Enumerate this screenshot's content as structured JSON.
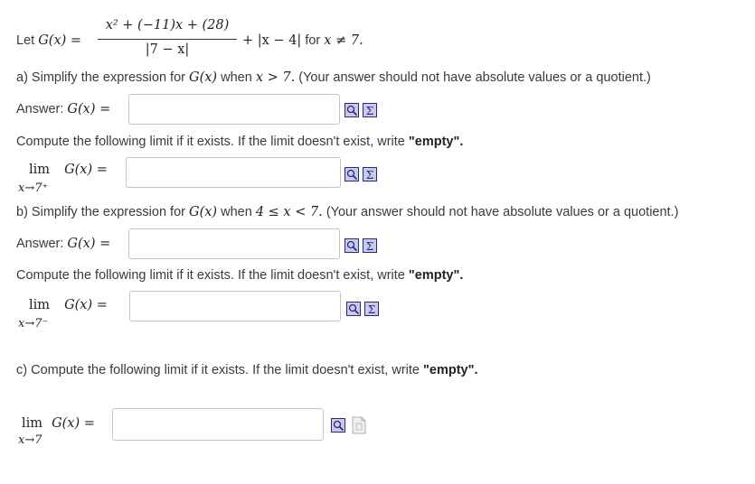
{
  "header": {
    "let_label": "Let",
    "func_lhs": "G(x) =",
    "numerator": "x² + (−11)x + (28)",
    "denominator": "|7 − x|",
    "tail_expr": "+ |x − 4|",
    "for_label": "for",
    "condition": "x ≠ 7."
  },
  "part_a": {
    "prompt_prefix": "a) Simplify the expression for",
    "prompt_func": "G(x)",
    "prompt_when": "when",
    "prompt_cond": "x > 7.",
    "prompt_suffix": "(Your answer should not have absolute values or a quotient.)",
    "answer_label": "Answer:",
    "answer_expr": "G(x) =",
    "answer_value": ""
  },
  "limit_instruction": {
    "text": "Compute the following limit if it exists. If the limit doesn't exist, write ",
    "emph": "\"empty\"."
  },
  "limit_a": {
    "lim": "lim",
    "expr": "G(x) =",
    "sub": "x→7⁺",
    "value": ""
  },
  "part_b": {
    "prompt_prefix": "b) Simplify the expression for",
    "prompt_func": "G(x)",
    "prompt_when": "when",
    "prompt_cond": "4 ≤ x < 7.",
    "prompt_suffix": "(Your answer should not have absolute values or a quotient.)",
    "answer_label": "Answer:",
    "answer_expr": "G(x) =",
    "answer_value": ""
  },
  "limit_b": {
    "lim": "lim",
    "expr": "G(x) =",
    "sub": "x→7⁻",
    "value": ""
  },
  "part_c": {
    "prompt_text": "c) Compute the following limit if it exists. If the limit doesn't exist, write ",
    "emph": "\"empty\".",
    "lim": "lim",
    "expr": "G(x) =",
    "sub": "x→7",
    "value": ""
  },
  "icons": {
    "preview": "preview-icon",
    "equation_editor": "equation-editor-icon"
  },
  "colors": {
    "icon_fill": "#c7c9f0",
    "icon_stroke": "#2a2a6e",
    "border": "#c4c4c4"
  }
}
